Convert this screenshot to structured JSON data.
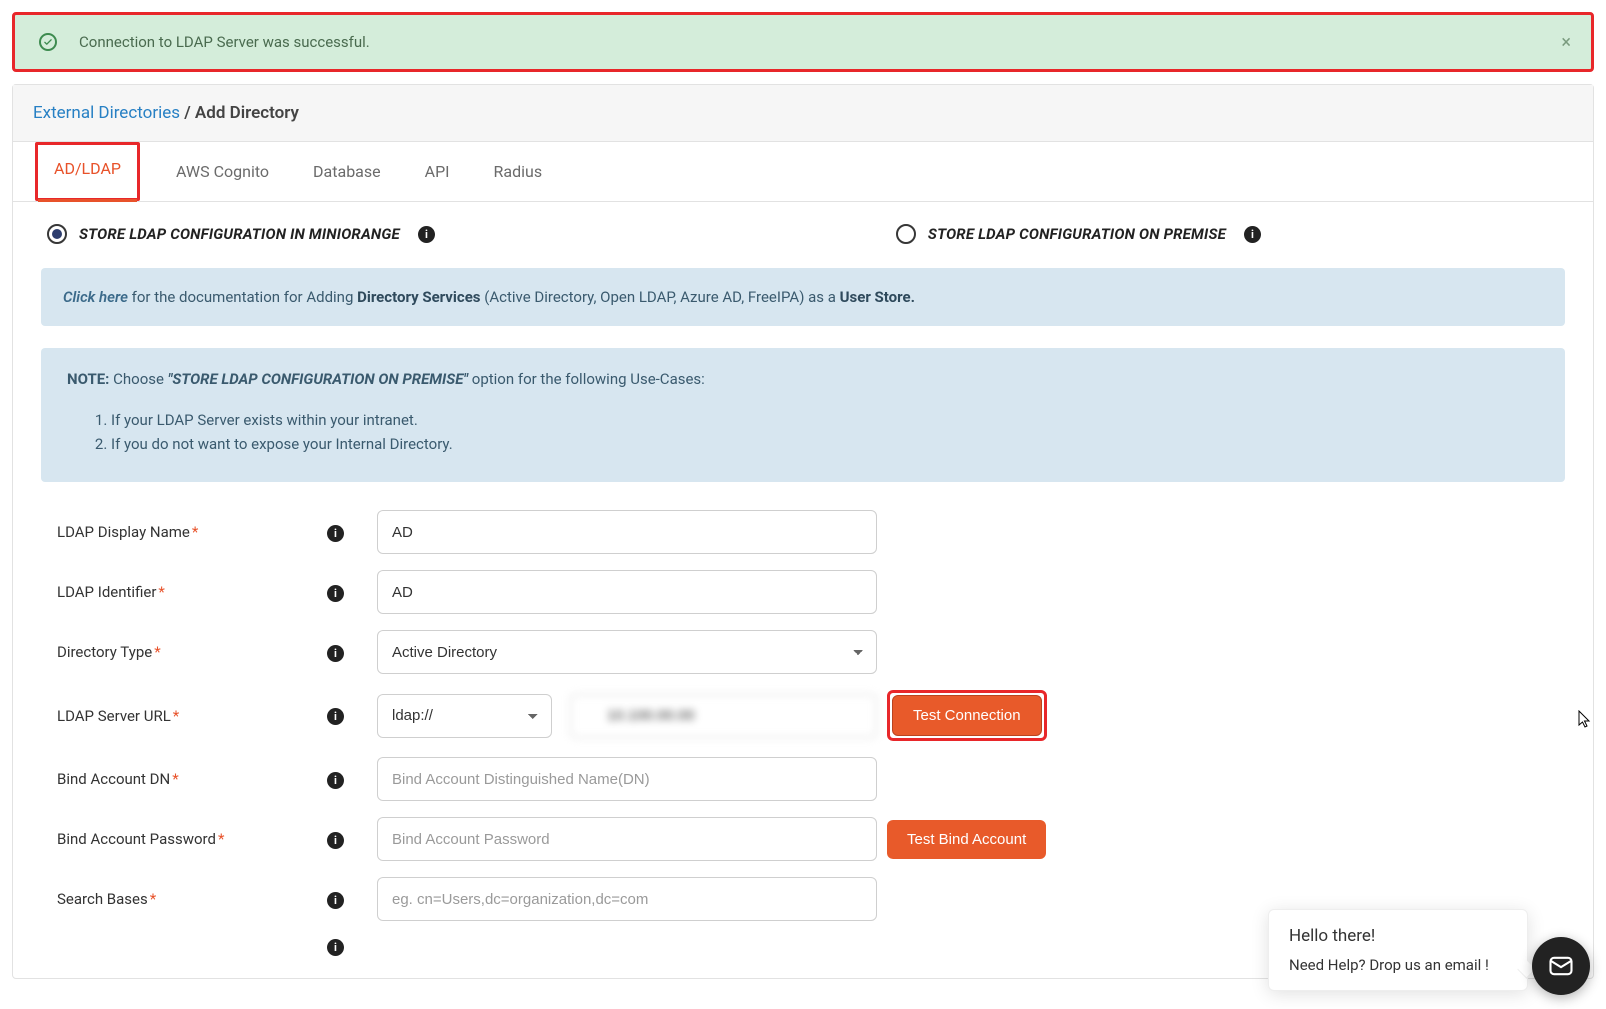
{
  "alert": {
    "message": "Connection to LDAP Server was successful."
  },
  "breadcrumb": {
    "parent": "External Directories",
    "sep": " / ",
    "current": "Add Directory"
  },
  "tabs": [
    "AD/LDAP",
    "AWS Cognito",
    "Database",
    "API",
    "Radius"
  ],
  "radios": {
    "opt1": "STORE LDAP CONFIGURATION IN MINIORANGE",
    "opt2": "STORE LDAP CONFIGURATION ON PREMISE"
  },
  "info_banner": {
    "click_here": "Click here",
    "text1": " for the documentation for Adding ",
    "strong1": "Directory Services",
    "text2": " (Active Directory, Open LDAP, Azure AD, FreeIPA) as a ",
    "strong2": "User Store."
  },
  "note_banner": {
    "note": "NOTE:",
    "choose": "  Choose ",
    "quote": "\"STORE LDAP CONFIGURATION ON PREMISE\"",
    "tail": " option for the following Use-Cases:",
    "li1": "If your LDAP Server exists within your intranet.",
    "li2": "If you do not want to expose your Internal Directory."
  },
  "fields": {
    "display_name": {
      "label": "LDAP Display Name",
      "value": "AD"
    },
    "identifier": {
      "label": "LDAP Identifier",
      "value": "AD"
    },
    "dir_type": {
      "label": "Directory Type",
      "value": "Active Directory"
    },
    "server_url": {
      "label": "LDAP Server URL",
      "protocol": "ldap://",
      "host": "10.100.00.00"
    },
    "bind_dn": {
      "label": "Bind Account DN",
      "placeholder": "Bind Account Distinguished Name(DN)"
    },
    "bind_pw": {
      "label": "Bind Account Password",
      "placeholder": "Bind Account Password"
    },
    "search_bases": {
      "label": "Search Bases",
      "placeholder": "eg. cn=Users,dc=organization,dc=com"
    }
  },
  "buttons": {
    "test_conn": "Test Connection",
    "test_bind": "Test Bind Account"
  },
  "chat": {
    "line1": "Hello there!",
    "line2": "Need Help? Drop us an email !"
  }
}
